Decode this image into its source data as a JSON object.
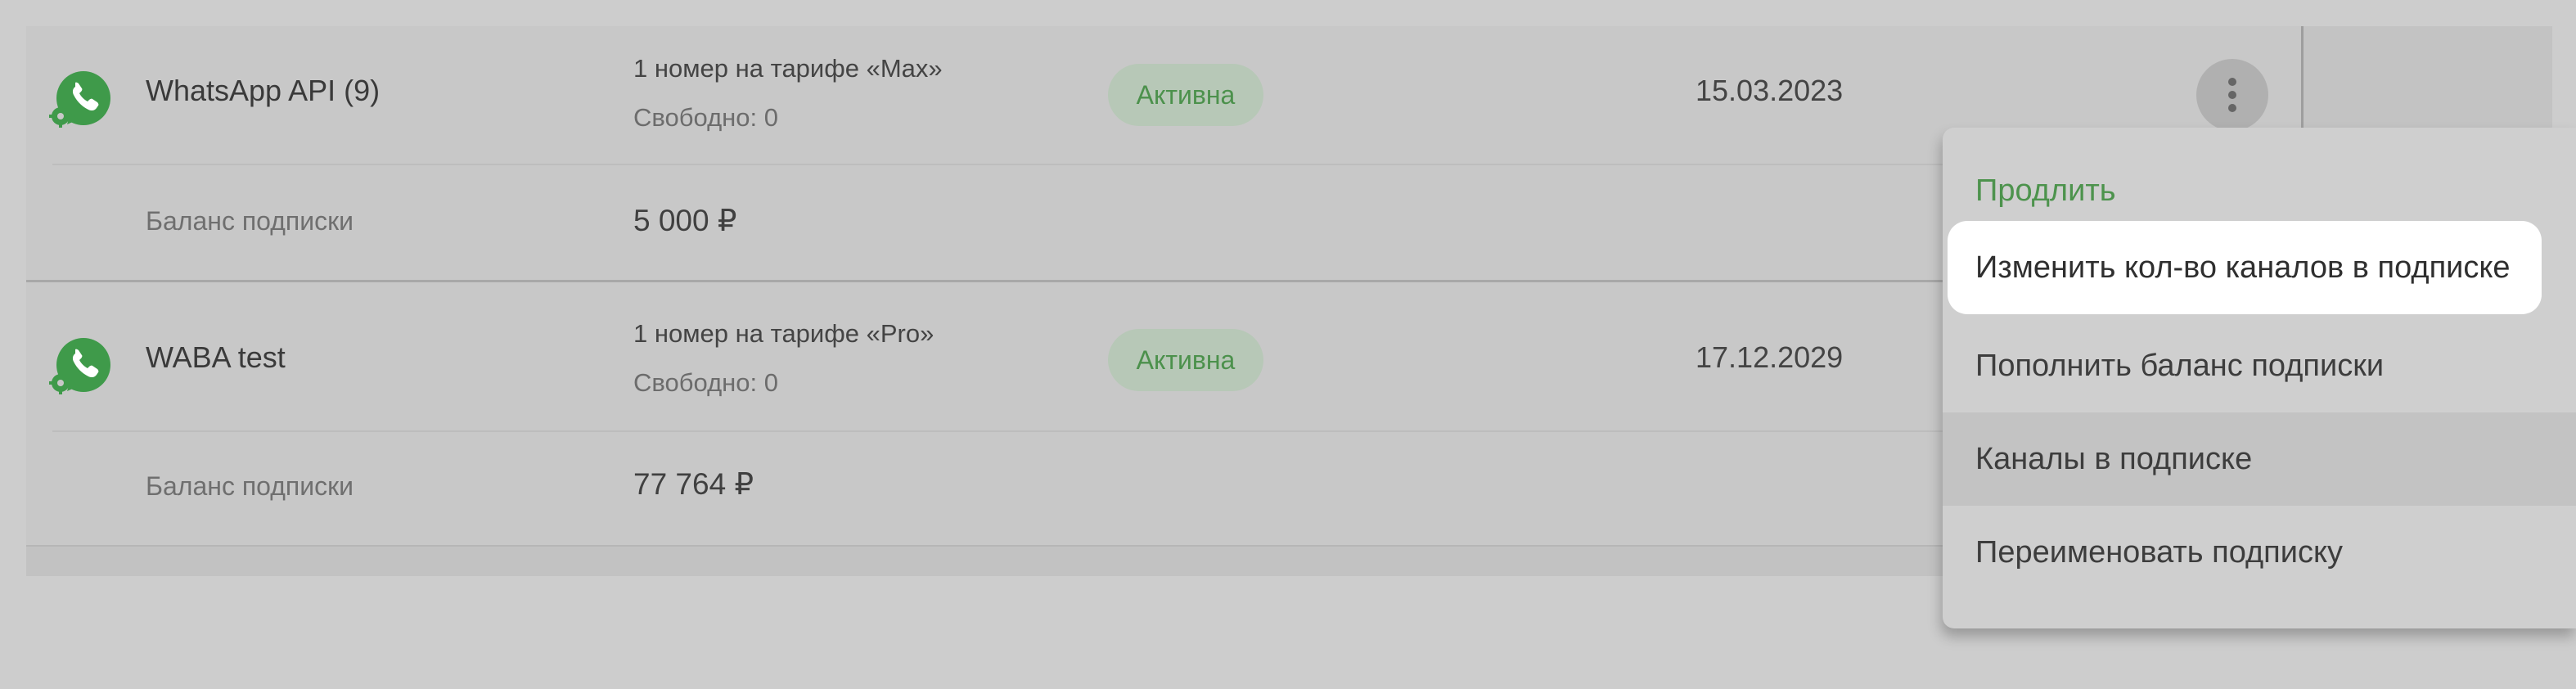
{
  "subscriptions": [
    {
      "name": "WhatsApp API (9)",
      "plan": "1 номер на тарифе «Max»",
      "free": "Свободно: 0",
      "status": "Активна",
      "date": "15.03.2023",
      "balance_label": "Баланс подписки",
      "balance_value": "5 000 ₽",
      "icon": "whatsapp-icon"
    },
    {
      "name": "WABA test",
      "plan": "1 номер на тарифе «Pro»",
      "free": "Свободно: 0",
      "status": "Активна",
      "date": "17.12.2029",
      "balance_label": "Баланс подписки",
      "balance_value": "77 764 ₽",
      "icon": "whatsapp-icon"
    }
  ],
  "menu": {
    "items": [
      {
        "label": "Продлить"
      },
      {
        "label": "Изменить кол-во каналов в подписке"
      },
      {
        "label": "Пополнить баланс подписки"
      },
      {
        "label": "Каналы в подписке"
      },
      {
        "label": "Переименовать подписку"
      }
    ]
  },
  "colors": {
    "accent_green": "#4d934d",
    "badge_bg": "#b7c8b7",
    "whatsapp_green": "#3f9a4a"
  }
}
